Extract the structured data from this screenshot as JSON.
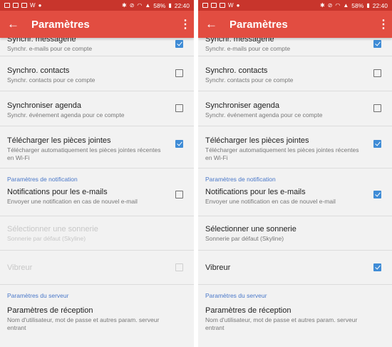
{
  "status": {
    "battery": "58%",
    "time": "22:40",
    "left_letter": "W"
  },
  "colors": {
    "appbar": "#e24d41",
    "statusbar": "#c8352c",
    "checkbox": "#3f8cd6",
    "section": "#4a78c9"
  },
  "screens": [
    {
      "appbar": {
        "title": "Paramètres",
        "back_icon": "arrow-left-icon",
        "menu_icon": "more-vert-icon"
      },
      "items": [
        {
          "title": "Synchr. messagerie",
          "subtitle": "Synchr. e-mails pour ce compte",
          "checked": true,
          "disabled": false
        },
        {
          "title": "Synchro. contacts",
          "subtitle": "Synchr. contacts pour ce compte",
          "checked": false,
          "disabled": false
        },
        {
          "title": "Synchroniser agenda",
          "subtitle": "Synchr. événement agenda pour ce compte",
          "checked": false,
          "disabled": false
        },
        {
          "title": "Télécharger les pièces jointes",
          "subtitle": "Télécharger automatiquement les pièces jointes récentes en Wi-Fi",
          "checked": true,
          "disabled": false
        },
        {
          "section": "Paramètres de notification"
        },
        {
          "title": "Notifications pour les e-mails",
          "subtitle": "Envoyer une notification en cas de nouvel e-mail",
          "checked": false,
          "disabled": false
        },
        {
          "title": "Sélectionner une sonnerie",
          "subtitle": "Sonnerie par défaut (Skyline)",
          "disabled": true
        },
        {
          "title": "Vibreur",
          "checked": false,
          "disabled": true
        },
        {
          "section": "Paramètres du serveur"
        },
        {
          "title": "Paramètres de réception",
          "subtitle": "Nom d'utilisateur, mot de passe et autres param. serveur entrant",
          "disabled": false
        }
      ]
    },
    {
      "appbar": {
        "title": "Paramètres",
        "back_icon": "arrow-left-icon",
        "menu_icon": "more-vert-icon"
      },
      "items": [
        {
          "title": "Synchr. messagerie",
          "subtitle": "Synchr. e-mails pour ce compte",
          "checked": true,
          "disabled": false
        },
        {
          "title": "Synchro. contacts",
          "subtitle": "Synchr. contacts pour ce compte",
          "checked": false,
          "disabled": false
        },
        {
          "title": "Synchroniser agenda",
          "subtitle": "Synchr. événement agenda pour ce compte",
          "checked": false,
          "disabled": false
        },
        {
          "title": "Télécharger les pièces jointes",
          "subtitle": "Télécharger automatiquement les pièces jointes récentes en Wi-Fi",
          "checked": true,
          "disabled": false
        },
        {
          "section": "Paramètres de notification"
        },
        {
          "title": "Notifications pour les e-mails",
          "subtitle": "Envoyer une notification en cas de nouvel e-mail",
          "checked": true,
          "disabled": false
        },
        {
          "title": "Sélectionner une sonnerie",
          "subtitle": "Sonnerie par défaut (Skyline)",
          "disabled": false
        },
        {
          "title": "Vibreur",
          "checked": true,
          "disabled": false
        },
        {
          "section": "Paramètres du serveur"
        },
        {
          "title": "Paramètres de réception",
          "subtitle": "Nom d'utilisateur, mot de passe et autres param. serveur entrant",
          "disabled": false
        }
      ]
    }
  ]
}
